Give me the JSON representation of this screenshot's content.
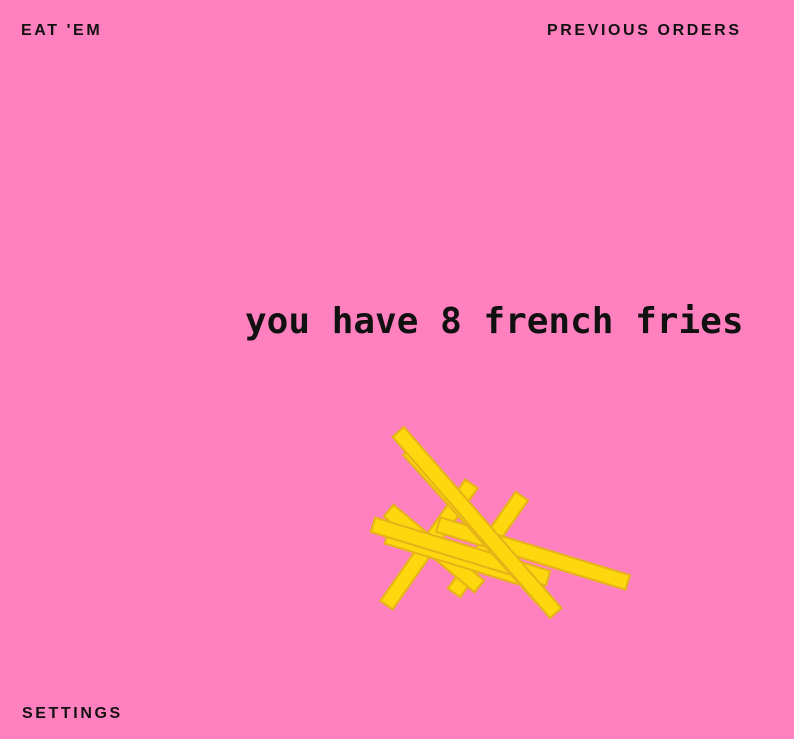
{
  "nav": {
    "eat_label": "EAT 'EM",
    "previous_orders_label": "PREVIOUS ORDERS",
    "settings_label": "SETTINGS"
  },
  "status": {
    "message": "you have 8 french fries",
    "fry_count": 8
  },
  "colors": {
    "background": "#ff80bf",
    "text": "#111111",
    "fry_fill": "#ffd70f",
    "fry_outline": "#e4b317"
  }
}
